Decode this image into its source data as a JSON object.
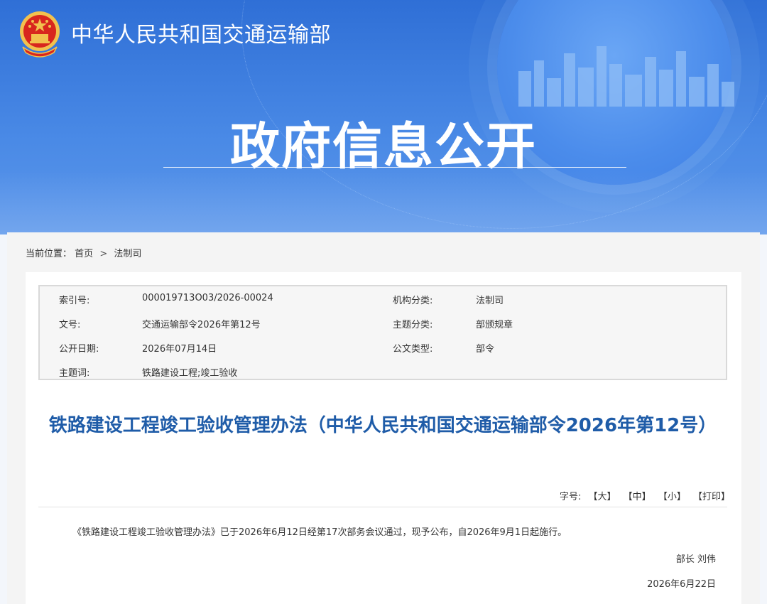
{
  "header": {
    "ministry_name": "中华人民共和国交通运输部",
    "page_title": "政府信息公开"
  },
  "breadcrumb": {
    "prefix": "当前位置：",
    "items": [
      "首页",
      "法制司"
    ],
    "separator": ">"
  },
  "meta": {
    "rows": [
      {
        "label1": "索引号:",
        "value1": "000019713O03/2026-00024",
        "label2": "机构分类:",
        "value2": "法制司"
      },
      {
        "label1": "文号:",
        "value1": "交通运输部令2026年第12号",
        "label2": "主题分类:",
        "value2": "部颁规章"
      },
      {
        "label1": "公开日期:",
        "value1": "2026年07月14日",
        "label2": "公文类型:",
        "value2": "部令"
      },
      {
        "label1": "主题词:",
        "value1": "铁路建设工程;竣工验收",
        "label2": "",
        "value2": ""
      }
    ]
  },
  "article": {
    "title": "铁路建设工程竣工验收管理办法（中华人民共和国交通运输部令2026年第12号）",
    "fontsize_label": "字号:",
    "fontsize_options": [
      "【大】",
      "【中】",
      "【小】",
      "【打印】"
    ],
    "body": "《铁路建设工程竣工验收管理办法》已于2026年6月12日经第17次部务会议通过，现予公布，自2026年9月1日起施行。",
    "signer": "部长 刘伟",
    "sign_date": "2026年6月22日"
  },
  "colors": {
    "banner_blue": "#2f6fd6",
    "title_blue": "#1f5ca8",
    "emblem_red": "#d8261e",
    "emblem_gold": "#f2c14e"
  }
}
